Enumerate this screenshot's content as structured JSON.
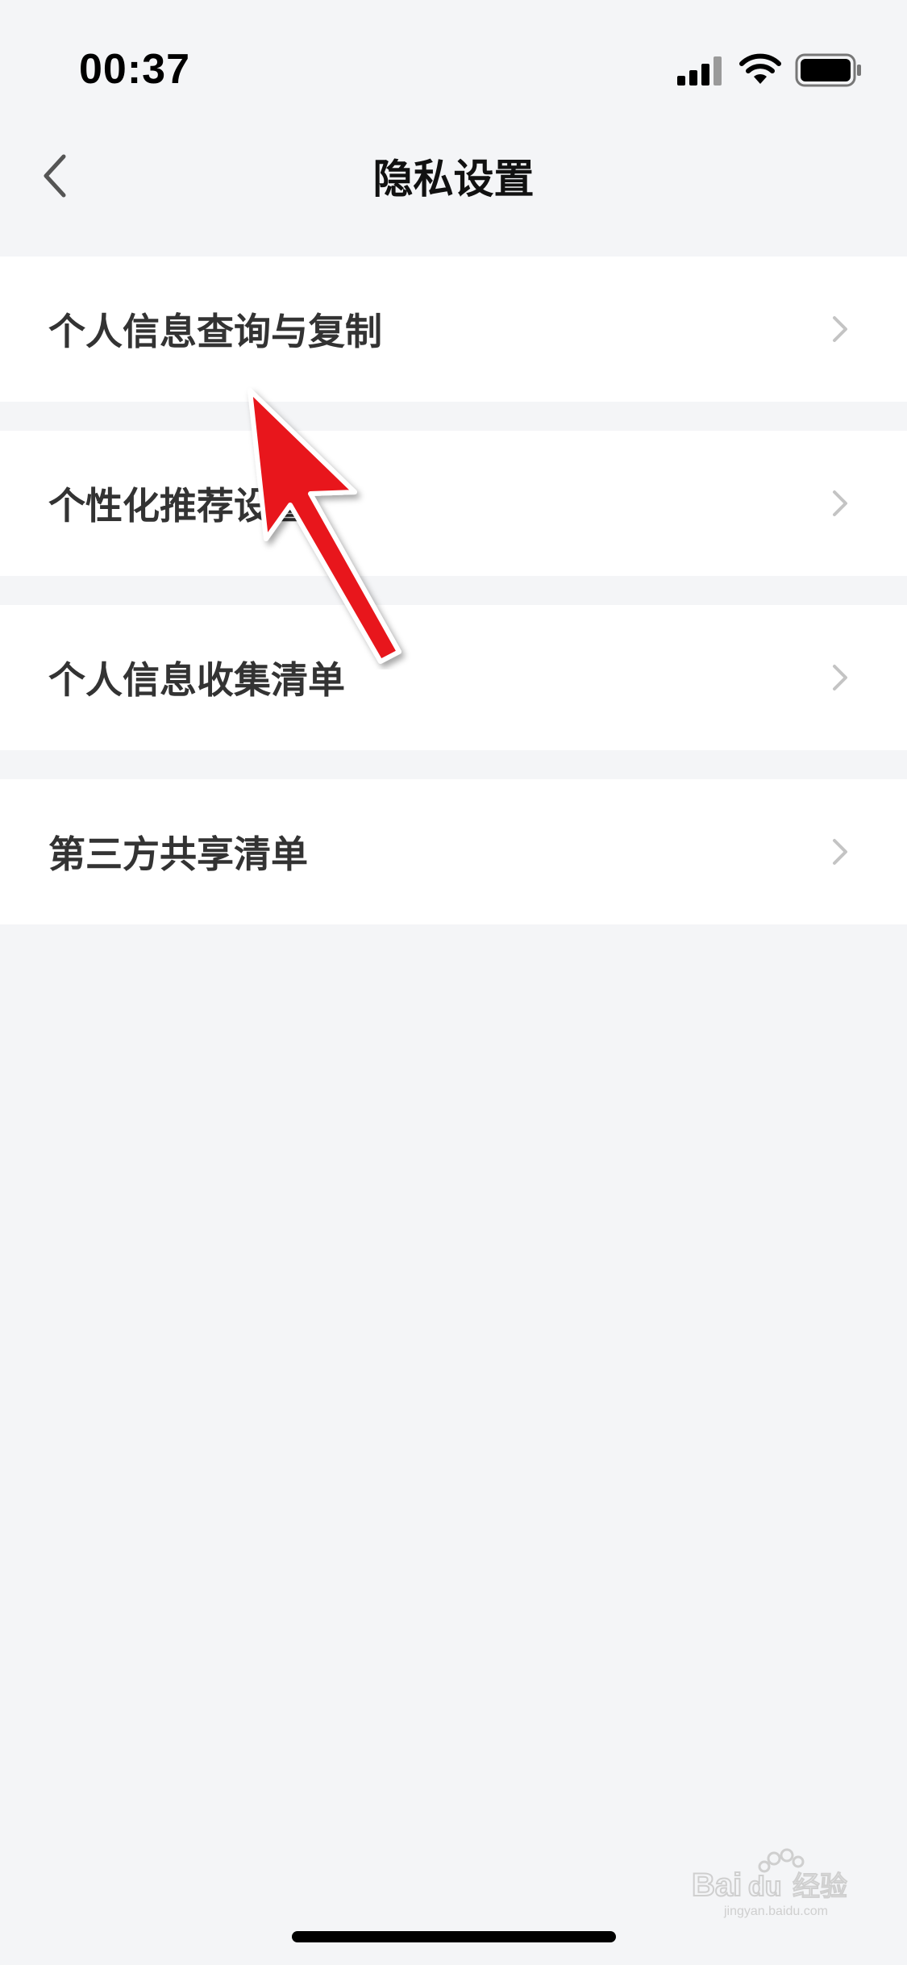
{
  "status_bar": {
    "time": "00:37",
    "icons": [
      "signal-icon",
      "wifi-icon",
      "battery-icon"
    ]
  },
  "nav": {
    "title": "隐私设置",
    "back_icon": "chevron-left-icon"
  },
  "settings": {
    "items": [
      {
        "label": "个人信息查询与复制"
      },
      {
        "label": "个性化推荐设置"
      },
      {
        "label": "个人信息收集清单"
      },
      {
        "label": "第三方共享清单"
      }
    ]
  },
  "colors": {
    "background": "#f4f5f7",
    "row": "#ffffff",
    "label": "#333333",
    "chevron": "#c4c4c4",
    "arrow": "#e8141c"
  },
  "watermark": {
    "brand": "Bai du 经验",
    "site": "jingyan.baidu.com"
  }
}
